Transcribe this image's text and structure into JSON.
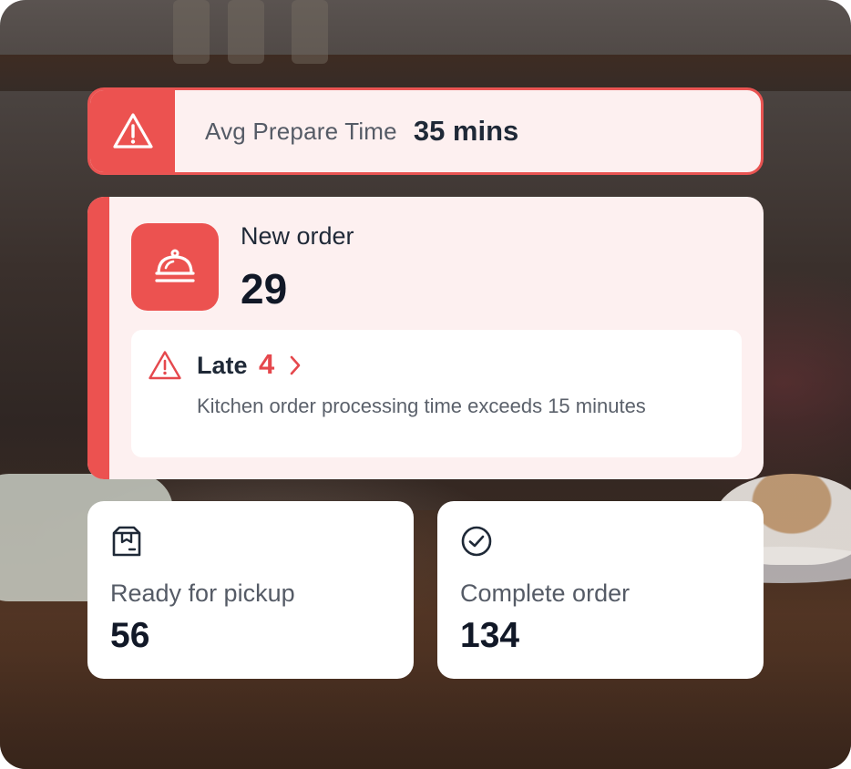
{
  "avg_prepare": {
    "icon": "warning-triangle-icon",
    "label": "Avg Prepare Time",
    "value": "35 mins"
  },
  "new_order": {
    "icon": "service-bell-icon",
    "label": "New order",
    "count": "29",
    "late": {
      "icon": "warning-triangle-icon",
      "label": "Late",
      "count": "4",
      "description": "Kitchen order processing time exceeds 15 minutes"
    }
  },
  "stats": [
    {
      "icon": "package-box-icon",
      "label": "Ready for pickup",
      "value": "56"
    },
    {
      "icon": "check-circle-icon",
      "label": "Complete order",
      "value": "134"
    }
  ],
  "colors": {
    "accent": "#ec5250",
    "card_tint": "#fdf0f0",
    "text_dark": "#111827",
    "text_muted": "#555b66"
  }
}
